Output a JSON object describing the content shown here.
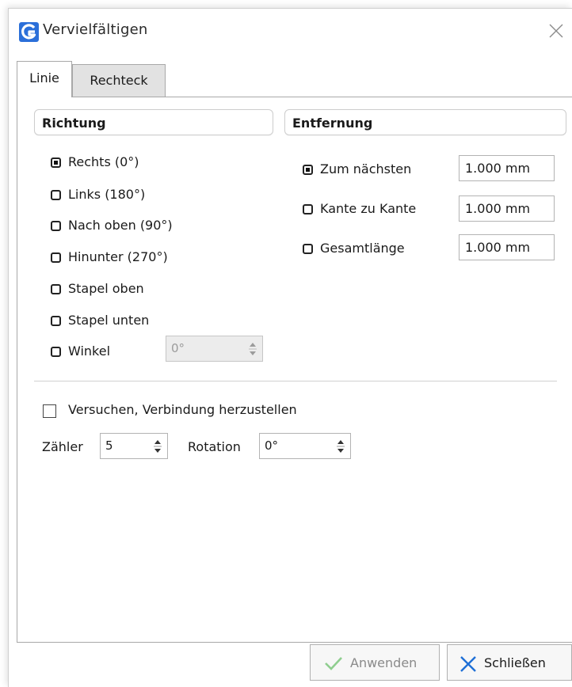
{
  "window": {
    "title": "Vervielfältigen"
  },
  "tabs": [
    {
      "label": "Linie",
      "active": true
    },
    {
      "label": "Rechteck",
      "active": false
    }
  ],
  "direction": {
    "header": "Richtung",
    "options": [
      {
        "label": "Rechts (0°)",
        "selected": true
      },
      {
        "label": "Links (180°)",
        "selected": false
      },
      {
        "label": "Nach oben (90°)",
        "selected": false
      },
      {
        "label": "Hinunter (270°)",
        "selected": false
      },
      {
        "label": "Stapel oben",
        "selected": false
      },
      {
        "label": "Stapel unten",
        "selected": false
      },
      {
        "label": "Winkel",
        "selected": false
      }
    ],
    "angle_value": "0°"
  },
  "distance": {
    "header": "Entfernung",
    "options": [
      {
        "label": "Zum nächsten",
        "selected": true,
        "value": "1.000 mm"
      },
      {
        "label": "Kante zu Kante",
        "selected": false,
        "value": "1.000 mm"
      },
      {
        "label": "Gesamtlänge",
        "selected": false,
        "value": "1.000 mm"
      }
    ]
  },
  "options": {
    "connect_label": "Versuchen, Verbindung herzustellen",
    "connect_checked": false,
    "count_label": "Zähler",
    "count_value": "5",
    "rotation_label": "Rotation",
    "rotation_value": "0°"
  },
  "buttons": {
    "apply_label": "Anwenden",
    "close_label": "Schließen"
  },
  "colors": {
    "accent": "#2b6fd9",
    "apply_check": "#8fce8f",
    "close_x": "#1f6fd6"
  },
  "icons": [
    "app-logo-icon",
    "close-icon",
    "check-icon",
    "x-icon",
    "spin-arrows-icon"
  ]
}
